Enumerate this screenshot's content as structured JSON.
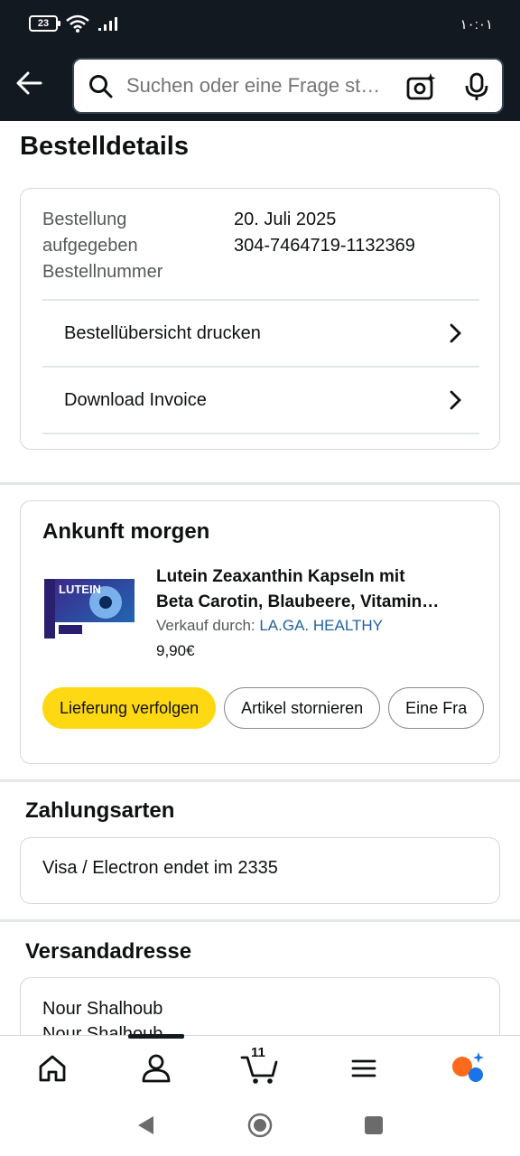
{
  "status_bar": {
    "battery": "23",
    "time": "١٠:٠١"
  },
  "search": {
    "placeholder": "Suchen oder eine Frage st…"
  },
  "page": {
    "title": "Bestelldetails"
  },
  "order_details": {
    "labels": [
      "Bestellung",
      "aufgegeben",
      "Bestellnummer"
    ],
    "values": [
      "20. Juli 2025",
      "304-7464719-1132369"
    ],
    "print_link": "Bestellübersicht drucken",
    "invoice_link": "Download Invoice"
  },
  "shipment": {
    "title": "Ankunft morgen",
    "product_name_line1": "Lutein Zeaxanthin Kapseln mit",
    "product_name_line2": "Beta Carotin, Blaubeere, Vitamin…",
    "seller_label": "Verkauf durch: ",
    "seller_name": "LA.GA. HEALTHY",
    "price": "9,90€",
    "image_text": "LUTEIN",
    "buttons": [
      "Lieferung verfolgen",
      "Artikel stornieren",
      "Eine Fra"
    ]
  },
  "payment": {
    "title": "Zahlungsarten",
    "method": "Visa / Electron  endet im 2335"
  },
  "shipping": {
    "title": "Versandadresse",
    "lines": [
      "Nour Shalhoub",
      "Nour Shalhoub"
    ]
  },
  "nav": {
    "cart_count": "11"
  },
  "colors": {
    "header": "#131921",
    "primary_button": "#ffd814",
    "link": "#2162a1"
  }
}
